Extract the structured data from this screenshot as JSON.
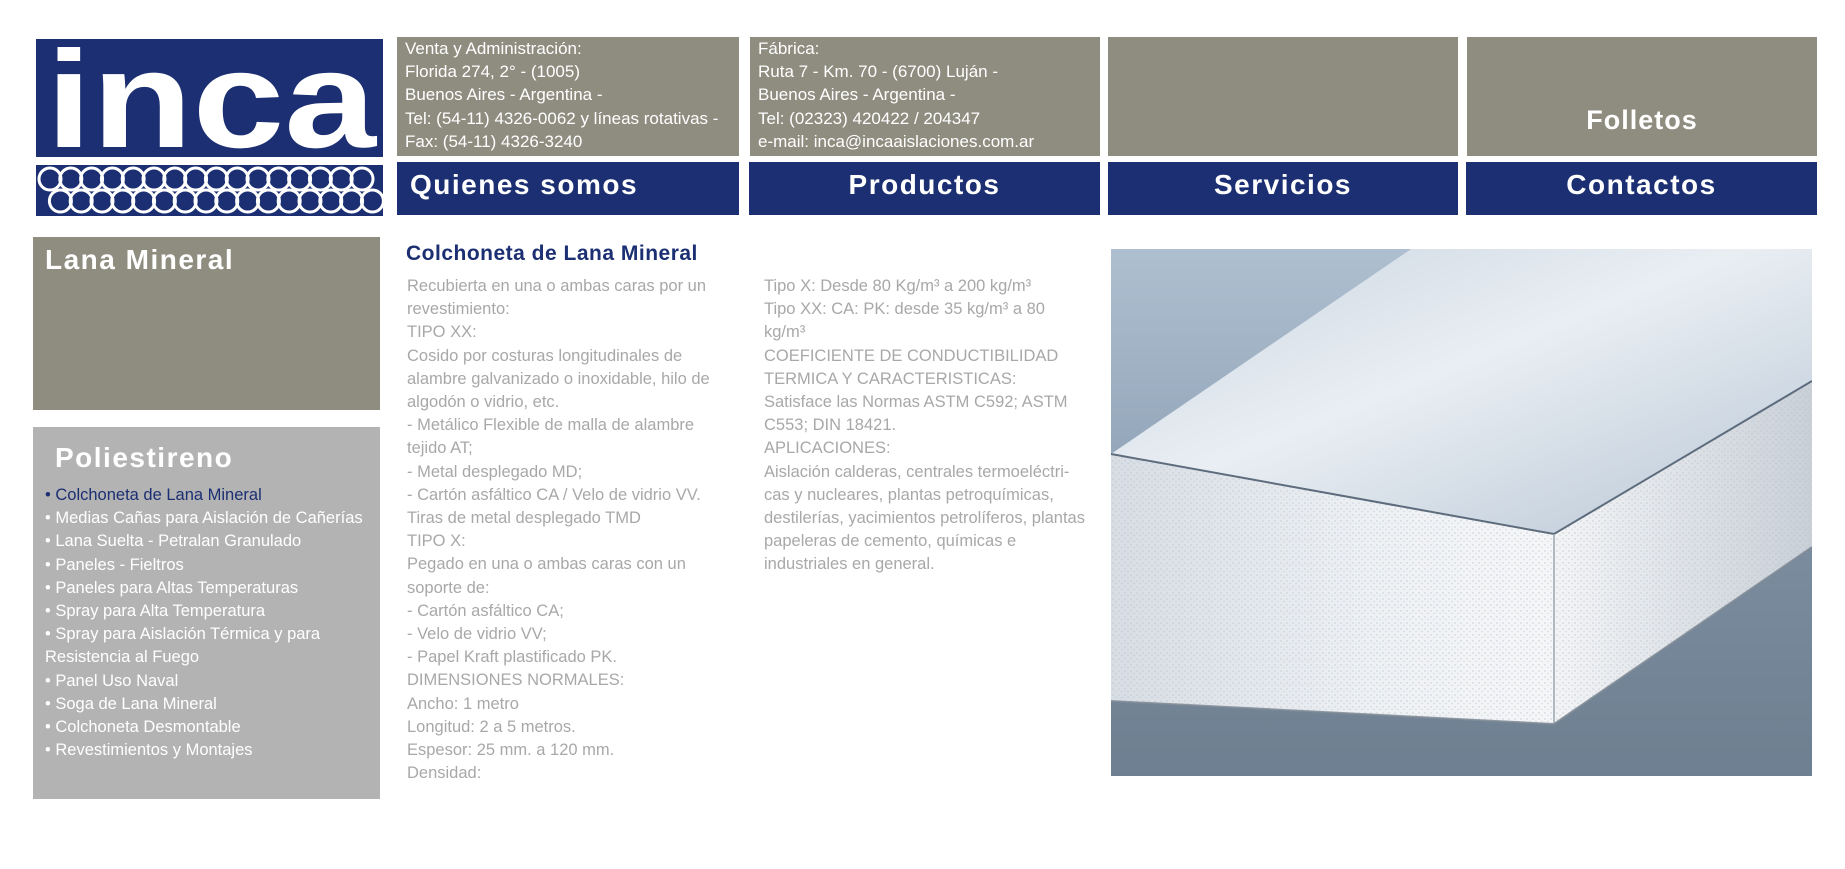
{
  "logo": {
    "text": "inca",
    "icon": "coil-pattern-icon",
    "color": "#1b2f72"
  },
  "header": {
    "venta": {
      "lines": [
        "Venta y Administración:",
        "Florida 274, 2° - (1005)",
        "Buenos Aires - Argentina -",
        "Tel: (54-11) 4326-0062 y líneas rotativas -",
        "Fax: (54-11) 4326-3240"
      ]
    },
    "fabrica": {
      "lines": [
        "Fábrica:",
        "Ruta 7 - Km. 70 - (6700) Luján -",
        "Buenos Aires - Argentina -",
        "Tel: (02323) 420422 / 204347",
        "e-mail: inca@incaaislaciones.com.ar"
      ]
    },
    "folletos_label": "Folletos"
  },
  "nav": {
    "quienes": "Quienes somos",
    "productos": "Productos",
    "servicios": "Servicios",
    "contactos": "Contactos"
  },
  "sidebar": {
    "lana_title": "Lana Mineral",
    "poli_title": "Poliestireno",
    "items": [
      "• Colchoneta de Lana Mineral",
      "• Medias Cañas para Aislación de Cañerías",
      "• Lana Suelta - Petralan Granulado",
      "• Paneles - Fieltros",
      "• Paneles para Altas Temperaturas",
      "• Spray para Alta Temperatura",
      "• Spray para Aislación Térmica y para",
      "Resistencia al Fuego",
      "• Panel Uso Naval",
      "• Soga de Lana Mineral",
      "• Colchoneta Desmontable",
      "• Revestimientos y Montajes"
    ]
  },
  "content": {
    "title": "Colchoneta de Lana Mineral",
    "left_lines": [
      "Recubierta en una o ambas caras por un",
      "revestimiento:",
      "TIPO XX:",
      "Cosido por costuras longitudinales de",
      "alambre galvanizado o inoxidable, hilo de",
      "algodón o vidrio, etc.",
      "- Metálico Flexible de malla de alambre",
      "tejido AT;",
      "- Metal desplegado MD;",
      "- Cartón asfáltico CA / Velo de vidrio VV.",
      "Tiras de metal desplegado TMD",
      "TIPO X:",
      "Pegado en una o ambas caras con un",
      "soporte de:",
      "- Cartón asfáltico CA;",
      "- Velo de vidrio VV;",
      "- Papel Kraft plastificado PK.",
      "DIMENSIONES NORMALES:",
      "Ancho: 1 metro",
      "Longitud: 2 a 5 metros.",
      "Espesor: 25 mm. a 120 mm.",
      "Densidad:"
    ],
    "right_lines": [
      "Tipo X: Desde 80 Kg/m³ a 200 kg/m³",
      "Tipo XX: CA: PK: desde 35 kg/m³ a 80",
      "kg/m³",
      "COEFICIENTE DE CONDUCTIBILIDAD",
      "TERMICA Y CARACTERISTICAS:",
      "Satisface las Normas ASTM C592; ASTM",
      "C553; DIN 18421.",
      "APLICACIONES:",
      "Aislación calderas, centrales termoeléctri-",
      "cas y nucleares, plantas petroquímicas,",
      "destilerías, yacimientos petrolíferos, plantas",
      "papeleras de cemento, químicas e",
      "industriales en general."
    ]
  },
  "colors": {
    "brand_blue": "#1b2f72",
    "gray_box": "#8f8d80",
    "sidebar_light": "#b3b3b3",
    "body_text": "#a8a8a8"
  }
}
